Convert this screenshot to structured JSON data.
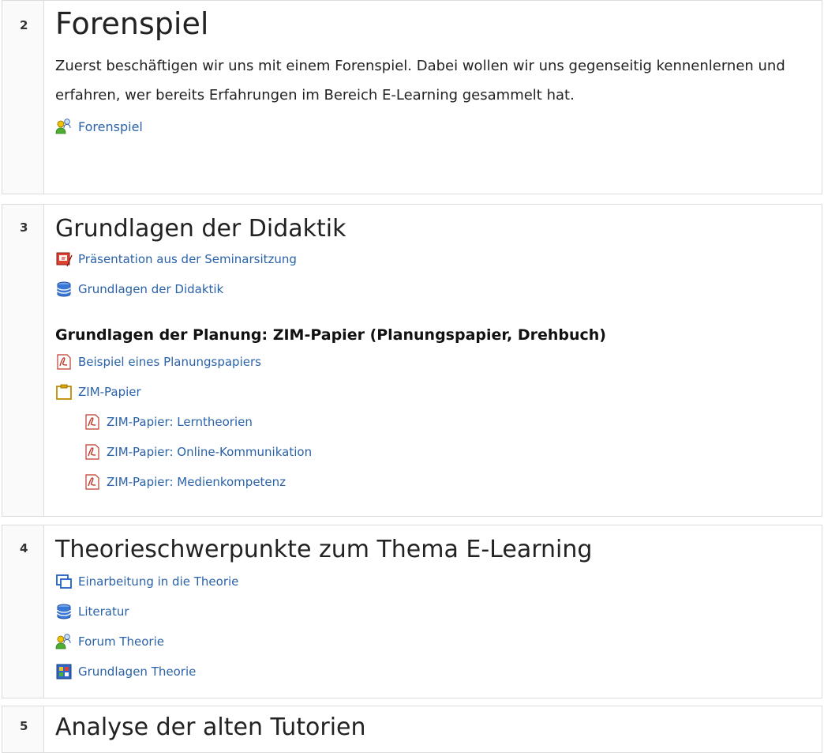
{
  "sections": [
    {
      "number": "2",
      "title": "Forenspiel",
      "summary": "Zuerst beschäftigen wir uns mit einem Forenspiel. Dabei wollen wir uns gegenseitig kennenlernen und erfahren, wer bereits Erfahrungen im Bereich E-Learning gesammelt hat.",
      "activities": [
        {
          "label": "Forenspiel",
          "icon": "forum-icon"
        }
      ]
    },
    {
      "number": "3",
      "title": "Grundlagen der Didaktik",
      "activities": [
        {
          "label": "Präsentation aus der Seminarsitzung",
          "icon": "presentation-icon"
        },
        {
          "label": "Grundlagen der Didaktik",
          "icon": "database-icon"
        }
      ],
      "subheading": "Grundlagen der Planung: ZIM-Papier (Planungspapier, Drehbuch)",
      "sub_activities": [
        {
          "label": "Beispiel eines Planungspapiers",
          "icon": "pdf-icon"
        },
        {
          "label": "ZIM-Papier",
          "icon": "folder-icon"
        }
      ],
      "nested_activities": [
        {
          "label": "ZIM-Papier: Lerntheorien",
          "icon": "pdf-icon"
        },
        {
          "label": "ZIM-Papier: Online-Kommunikation",
          "icon": "pdf-icon"
        },
        {
          "label": "ZIM-Papier: Medienkompetenz",
          "icon": "pdf-icon"
        }
      ]
    },
    {
      "number": "4",
      "title": "Theorieschwerpunkte zum Thema E-Learning",
      "activities": [
        {
          "label": "Einarbeitung in die Theorie",
          "icon": "window-icon"
        },
        {
          "label": "Literatur",
          "icon": "database-icon"
        },
        {
          "label": "Forum Theorie",
          "icon": "forum-icon"
        },
        {
          "label": "Grundlagen Theorie",
          "icon": "glossary-icon"
        }
      ]
    },
    {
      "number": "5",
      "title": "Analyse der alten Tutorien"
    }
  ],
  "colors": {
    "link": "#2a62a8",
    "border": "#dcdcdc"
  }
}
